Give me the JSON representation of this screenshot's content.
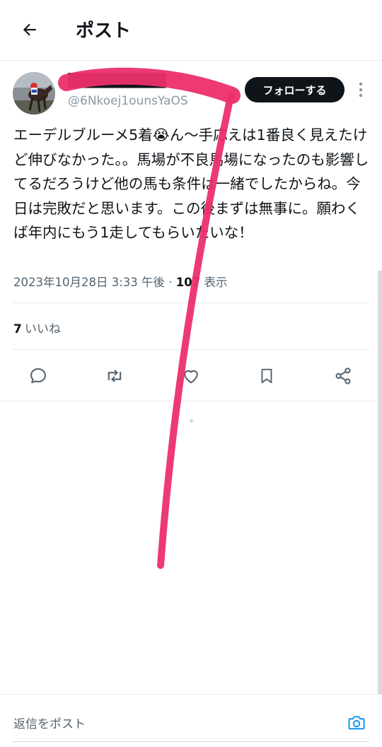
{
  "header": {
    "title": "ポスト",
    "back_icon": "arrow-left-icon"
  },
  "post": {
    "display_name": "██████████",
    "handle": "@6Nkoej1ounsYaOS",
    "follow_label": "フォローする",
    "text": "エーデルブルーメ5着😭ん〜手応えは1番良く見えたけど伸びなかった。。馬場が不良馬場になったのも影響してるだろうけど他の馬も条件は一緒でしたからね。今日は完敗だと思います。この後まずは無事に。願わくば年内にもう1走してもらいたいな！",
    "timestamp": "2023年10月28日 3:33 午後",
    "separator": "·",
    "views": "107",
    "views_label": "表示",
    "likes_count": "7",
    "likes_label": "いいね"
  },
  "actions": [
    {
      "name": "reply-icon"
    },
    {
      "name": "repost-icon"
    },
    {
      "name": "like-icon"
    },
    {
      "name": "bookmark-icon"
    },
    {
      "name": "share-icon"
    }
  ],
  "reply": {
    "placeholder": "返信をポスト",
    "camera_icon": "camera-icon"
  },
  "colors": {
    "text": "#0f1419",
    "secondary": "#536471",
    "accent": "#1d9bf0",
    "scribble": "#ec2f6b"
  }
}
